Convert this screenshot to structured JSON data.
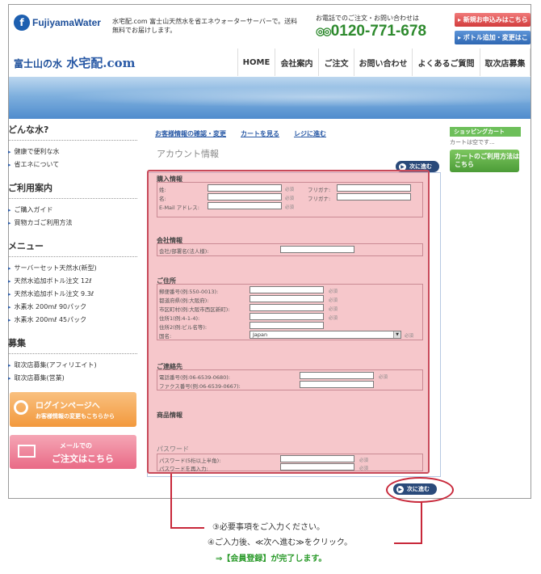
{
  "header": {
    "logo_text": "FujiyamaWater",
    "description": "水宅配.com 富士山天然水を省エネウォーターサーバーで。送料無料でお届けします。",
    "tel_label": "お電話でのご注文・お問い合わせは",
    "tel_number": "0120-771-678",
    "btn_new": "▸ 新規お申込みはこちら",
    "btn_add": "▸ ボトル追加・変更はこちら"
  },
  "nav": {
    "brand_kanji": "富士山の水",
    "brand_name": "水宅配.com",
    "items": [
      "HOME",
      "会社案内",
      "ご注文",
      "お問い合わせ",
      "よくあるご質問",
      "取次店募集"
    ]
  },
  "sidebar": {
    "h1": "どんな水?",
    "list1": [
      "健康で便利な水",
      "省エネについて"
    ],
    "h2": "ご利用案内",
    "list2": [
      "ご購入ガイド",
      "買物カゴご利用方法"
    ],
    "h3": "メニュー",
    "list3": [
      "サーバーセット天然水(新型)",
      "天然水追加ボトル注文 12ℓ",
      "天然水追加ボトル注文 9.3ℓ",
      "水素水 200mℓ 90パック",
      "水素水 200mℓ 45パック"
    ],
    "h4": "募集",
    "list4": [
      "取次店募集(アフィリエイト)",
      "取次店募集(営業)"
    ],
    "login_t1": "ログインページへ",
    "login_t2": "お客様情報の変更もこちらから",
    "mail_t1": "メールでの",
    "mail_t2": "ご注文はこちら"
  },
  "main": {
    "links": [
      "お客様情報の確認・変更",
      "カートを見る",
      "レジに進む"
    ],
    "title": "アカウント情報",
    "next_label": "次に進む",
    "cart_head": "ショッピングカート",
    "cart_empty": "カートは空です...",
    "cart_btn": "カートのご利用方法はこちら"
  },
  "form": {
    "sec1": "購入情報",
    "sec1_rows": [
      "姓:",
      "名:",
      "E-Mail アドレス:"
    ],
    "sec1_kana": [
      "フリガナ:",
      "フリガナ:"
    ],
    "sec2": "会社情報",
    "sec2_rows": [
      "会社/部署名(法人様):"
    ],
    "sec3": "ご住所",
    "sec3_rows": [
      "郵便番号(例:550-0013):",
      "都道府県(例:大阪府):",
      "市区町村(例:大阪市西区新町):",
      "住所1(例:4-1-4):",
      "住所2(例:ビル名等):",
      "国名:"
    ],
    "country": "Japan",
    "sec4": "ご連絡先",
    "sec4_rows": [
      "電話番号(例:06-6539-0680):",
      "ファクス番号(例:06-6539-0667):"
    ],
    "sec5": "商品情報",
    "sec6": "パスワード",
    "sec6_rows": [
      "パスワード(5桁以上半角):",
      "パスワードを再入力:"
    ],
    "req": "必須"
  },
  "notes": {
    "n1": "③必要事項をご入力ください。",
    "n2": "④ご入力後、≪次へ進む≫をクリック。",
    "n3": "⇒【会員登録】が完了します。"
  },
  "colors": {
    "overlay": "#ec828c",
    "accent_red": "#c8283a",
    "brand_blue": "#2a5aa6",
    "note_green": "#2a9a2a"
  }
}
